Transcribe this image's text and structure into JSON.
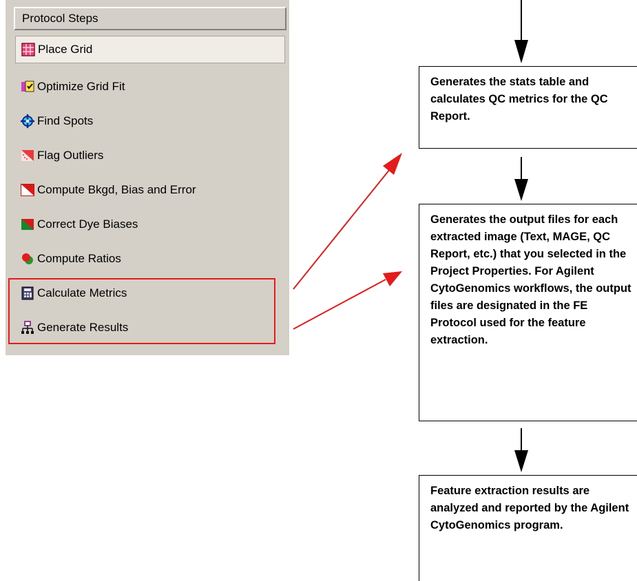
{
  "panel": {
    "header": "Protocol Steps",
    "steps": [
      {
        "label": "Place Grid",
        "icon": "place-grid-icon"
      },
      {
        "label": "Optimize Grid Fit",
        "icon": "optimize-grid-fit-icon"
      },
      {
        "label": "Find Spots",
        "icon": "find-spots-icon"
      },
      {
        "label": "Flag Outliers",
        "icon": "flag-outliers-icon"
      },
      {
        "label": "Compute Bkgd, Bias and Error",
        "icon": "compute-bkgd-icon"
      },
      {
        "label": "Correct Dye Biases",
        "icon": "correct-dye-biases-icon"
      },
      {
        "label": "Compute Ratios",
        "icon": "compute-ratios-icon"
      },
      {
        "label": "Calculate Metrics",
        "icon": "calculate-metrics-icon"
      },
      {
        "label": "Generate Results",
        "icon": "generate-results-icon"
      }
    ],
    "selected_step": "Place Grid"
  },
  "flow": {
    "boxes": [
      {
        "text": "Generates the stats table and calculates QC metrics for the QC Report."
      },
      {
        "text": "Generates the output files for each extracted image (Text, MAGE, QC Report, etc.) that you selected in the Project Properties. For Agilent CytoGenomics workflows, the output files are designated in the FE Protocol used for the feature extraction."
      },
      {
        "text": "Feature extraction results are analyzed and reported by the Agilent CytoGenomics program."
      }
    ]
  },
  "colors": {
    "panel_bg": "#d4d0c8",
    "highlight": "#e31b1b",
    "selected_bg": "#f0ece6",
    "arrow": "#000000"
  }
}
